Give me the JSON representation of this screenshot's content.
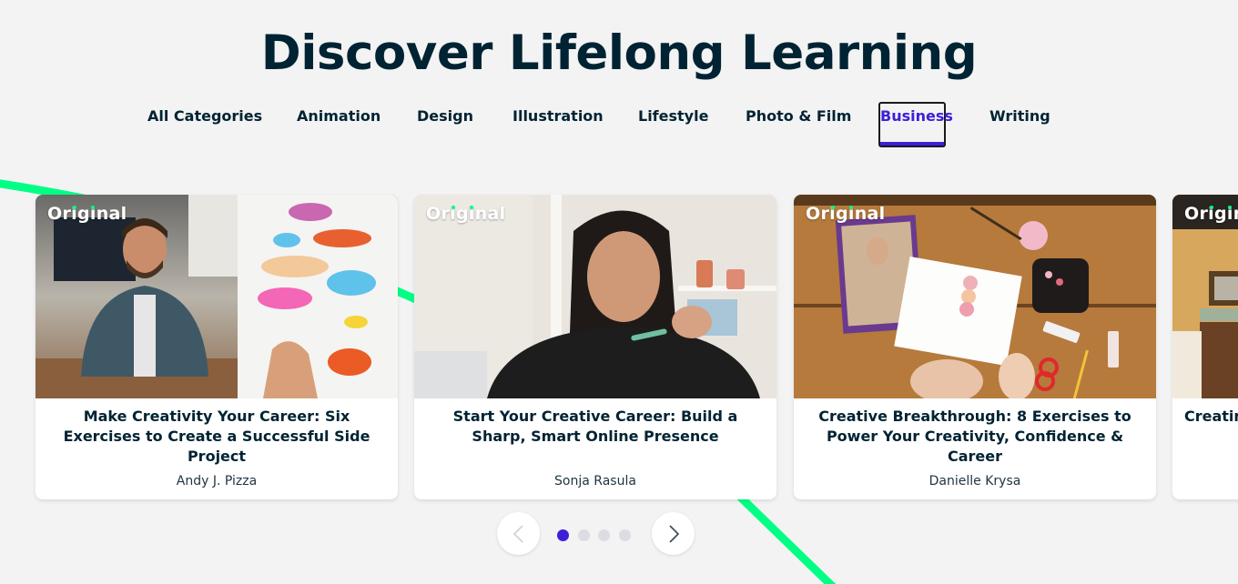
{
  "header": {
    "title": "Discover Lifelong Learning"
  },
  "tabs": [
    {
      "label": "All Categories",
      "active": false
    },
    {
      "label": "Animation",
      "active": false
    },
    {
      "label": "Design",
      "active": false
    },
    {
      "label": "Illustration",
      "active": false
    },
    {
      "label": "Lifestyle",
      "active": false
    },
    {
      "label": "Photo & Film",
      "active": false
    },
    {
      "label": "Business",
      "active": true
    },
    {
      "label": "Writing",
      "active": false
    }
  ],
  "cards": [
    {
      "badge": "Original",
      "title": "Make Creativity Your Career: Six Exercises to Create a Successful Side Project",
      "author": "Andy J. Pizza",
      "image": "man-whiteboard-flowchart"
    },
    {
      "badge": "Original",
      "title": "Start Your Creative Career: Build a Sharp, Smart Online Presence",
      "author": "Sonja Rasula",
      "image": "woman-at-laptop"
    },
    {
      "badge": "Original",
      "title": "Creative Breakthrough: 8 Exercises to Power Your Creativity, Confidence & Career",
      "author": "Danielle Krysa",
      "image": "collage-on-wood-table"
    },
    {
      "badge": "Original",
      "title": "Creatin",
      "author": "",
      "image": "living-room-interior"
    }
  ],
  "pagination": {
    "total_pages": 4,
    "current_page": 1,
    "prev_icon": "chevron-left-icon",
    "next_icon": "chevron-right-icon",
    "prev_disabled": true
  },
  "colors": {
    "accent": "#3b20d8",
    "brand_green": "#00ff84",
    "text_dark": "#002333",
    "background": "#f3f3f3",
    "dot_inactive": "#dcdde2"
  }
}
